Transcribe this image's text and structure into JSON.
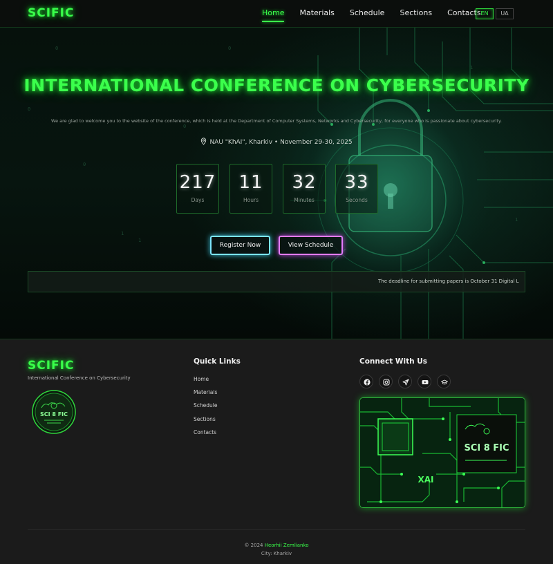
{
  "nav": {
    "logo": "SCIFIC",
    "links": [
      "Home",
      "Materials",
      "Schedule",
      "Sections",
      "Contacts"
    ],
    "active": "Home",
    "lang_en": "EN",
    "lang_ua": "UA"
  },
  "hero": {
    "title": "INTERNATIONAL CONFERENCE ON CYBERSECURITY",
    "subtitle": "We are glad to welcome you to the website of the conference, which is held at the Department of Computer Systems, Networks and Cybersecurity, for everyone who is passionate about cybersecurity.",
    "location": "NAU \"KhAI\", Kharkiv • November 29-30, 2025",
    "countdown": [
      {
        "value": "217",
        "label": "Days"
      },
      {
        "value": "11",
        "label": "Hours"
      },
      {
        "value": "32",
        "label": "Minutes"
      },
      {
        "value": "33",
        "label": "Seconds"
      }
    ],
    "register_label": "Register Now",
    "schedule_label": "View Schedule",
    "ticker": "The deadline for submitting papers is October 31          Digital L"
  },
  "footer": {
    "logo": "SCIFIC",
    "tagline": "International Conference on Cybersecurity",
    "badge_text": "SCI 8 FIC",
    "quick_links_title": "Quick Links",
    "quick_links": [
      "Home",
      "Materials",
      "Schedule",
      "Sections",
      "Contacts"
    ],
    "connect_title": "Connect With Us",
    "social_icons": [
      "facebook-icon",
      "instagram-icon",
      "telegram-icon",
      "youtube-icon",
      "graduation-cap-icon"
    ],
    "board_text": "SCI 8 FIC",
    "board_mark": "XAI",
    "copyright_prefix": "© 2024",
    "author": "Heorhii Zemlianko",
    "city": "City: Kharkiv"
  },
  "colors": {
    "accent": "#39ff4a",
    "register_border": "#7ce6ff",
    "schedule_border": "#e57cff",
    "background": "#1b1b1b"
  }
}
